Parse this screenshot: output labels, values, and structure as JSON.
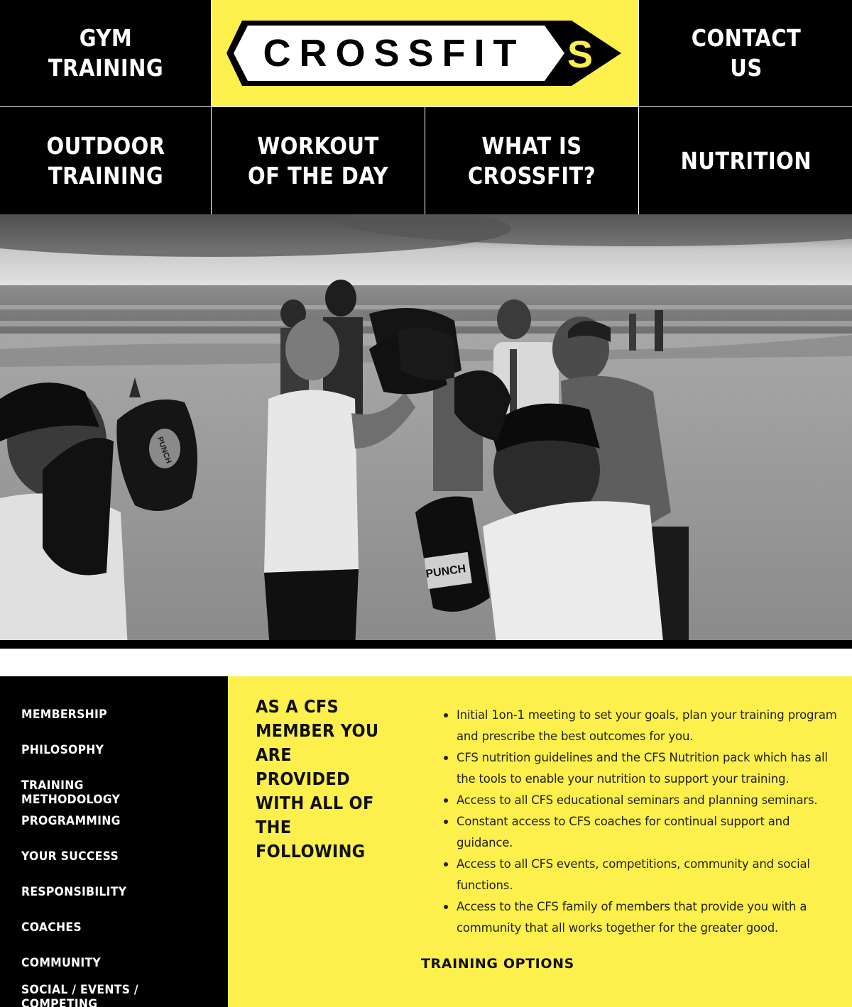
{
  "logo": {
    "wordmark": "CROSSFIT",
    "letter": "S",
    "brand_yellow": "#fdf04c",
    "brand_black": "#000000"
  },
  "nav": {
    "gym_training": "GYM TRAINING",
    "contact_us": "CONTACT US",
    "outdoor_training": "OUTDOOR TRAINING",
    "workout_of_the_day": "WORKOUT OF THE DAY",
    "what_is_crossfit": "WHAT IS CROSSFIT?",
    "nutrition": "NUTRITION"
  },
  "hero": {
    "image": "beach-boxing-training-photo",
    "pad_text": "PUNCH"
  },
  "sidebar": {
    "items": [
      {
        "label": "MEMBERSHIP"
      },
      {
        "label": "PHILOSOPHY"
      },
      {
        "label": "TRAINING METHODOLOGY"
      },
      {
        "label": "PROGRAMMING"
      },
      {
        "label": "YOUR SUCCESS"
      },
      {
        "label": "RESPONSIBILITY"
      },
      {
        "label": "COACHES"
      },
      {
        "label": "COMMUNITY"
      },
      {
        "label": "SOCIAL / EVENTS / COMPETING"
      }
    ]
  },
  "main": {
    "heading": "AS A CFS MEMBER YOU ARE PROVIDED WITH ALL OF THE FOLLOWING",
    "benefits": [
      "Initial 1on-1 meeting to set your goals, plan your training program and prescribe the best outcomes for you.",
      "CFS nutrition guidelines and the CFS Nutrition pack which has all the tools to enable your nutrition to support your training.",
      "Access to all CFS educational seminars and planning seminars.",
      "Constant access to CFS coaches for continual support and guidance.",
      "Access to all CFS events, competitions, community and social functions.",
      "Access to the CFS family of members that provide you with a community that all works together for the greater good."
    ],
    "training_options": "TRAINING OPTIONS"
  }
}
